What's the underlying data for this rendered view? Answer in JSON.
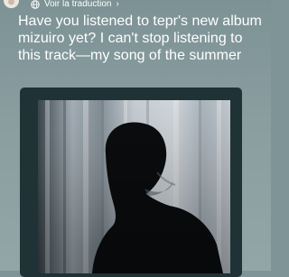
{
  "header": {
    "translate_label": "Voir la traduction",
    "chevron": "›",
    "avatar_icon": "avatar-icon",
    "translate_icon": "globe-icon"
  },
  "post": {
    "text": "Have you listened to tepr's new album mizuiro yet? I can't stop listening to this track—my song of the summer"
  },
  "media": {
    "image": "album-cover-image"
  },
  "colors": {
    "background": "#7f9497",
    "card": "#1f3236",
    "text": "#ffffff"
  }
}
